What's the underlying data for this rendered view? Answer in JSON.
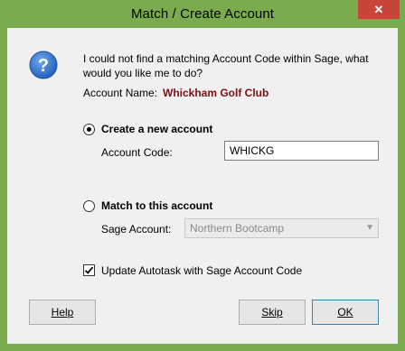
{
  "window": {
    "title": "Match / Create Account",
    "close_label": "✕"
  },
  "message": "I could not find a matching Account Code within Sage, what would you like me to do?",
  "account_name": {
    "label": "Account Name:",
    "value": "Whickham Golf Club"
  },
  "option_create": {
    "label": "Create a new account",
    "selected": true,
    "code_label": "Account Code:",
    "code_value": "WHICKG"
  },
  "option_match": {
    "label": "Match to this account",
    "selected": false,
    "sage_label": "Sage Account:",
    "sage_value": "Northern Bootcamp"
  },
  "update_checkbox": {
    "label": "Update Autotask with Sage Account Code",
    "checked": true
  },
  "buttons": {
    "help": "Help",
    "skip": "Skip",
    "ok": "OK"
  },
  "colors": {
    "accent": "#7aab4f",
    "account_name": "#7b1010",
    "icon_blue": "#2e6fc4"
  },
  "icons": {
    "dialog": "question-icon",
    "close": "close-icon",
    "dropdown": "chevron-down-icon"
  }
}
